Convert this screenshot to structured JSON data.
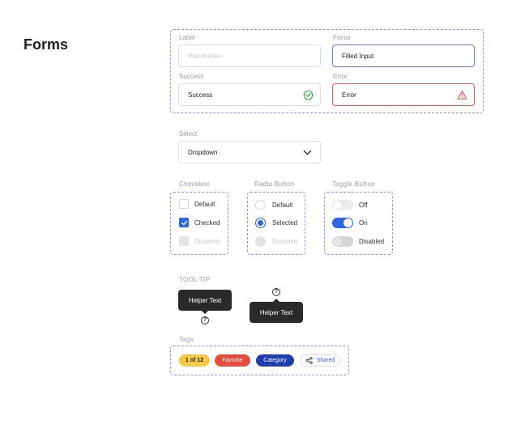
{
  "page": {
    "title": "Forms"
  },
  "inputs": {
    "label_caption": "Label",
    "label_placeholder": "Placeholder",
    "focus_caption": "Focus",
    "focus_value": "Filled Input",
    "success_caption": "Success",
    "success_value": "Success",
    "error_caption": "Error",
    "error_value": "Error"
  },
  "select": {
    "caption": "Select",
    "value": "Dropdown"
  },
  "checkbox": {
    "caption": "Checkbox",
    "items": [
      {
        "label": "Default",
        "state": "default"
      },
      {
        "label": "Checked",
        "state": "checked"
      },
      {
        "label": "Disabled",
        "state": "disabled"
      }
    ]
  },
  "radio": {
    "caption": "Radio Button",
    "items": [
      {
        "label": "Default",
        "state": "default"
      },
      {
        "label": "Selected",
        "state": "selected"
      },
      {
        "label": "Disabled",
        "state": "disabled"
      }
    ]
  },
  "toggle": {
    "caption": "Toggle Button",
    "items": [
      {
        "label": "Off",
        "state": "off"
      },
      {
        "label": "On",
        "state": "on"
      },
      {
        "label": "Disabled",
        "state": "disabled"
      }
    ]
  },
  "tooltip": {
    "caption": "TOOL TIP",
    "tip1": "Helper Text",
    "tip2": "Helper Text",
    "help_glyph": "?"
  },
  "tags": {
    "caption": "Tags",
    "items": [
      {
        "label": "1 of 12",
        "bg": "#f7c948",
        "fg": "#222222"
      },
      {
        "label": "Favorite",
        "bg": "#e64b3c",
        "fg": "#ffffff"
      },
      {
        "label": "Category",
        "bg": "#1f3fae",
        "fg": "#ffffff"
      },
      {
        "label": "Shared",
        "bg": "#ffffff",
        "fg": "#2f66e0",
        "icon": "share-icon"
      }
    ]
  },
  "colors": {
    "accent": "#2f66e0",
    "success": "#2fa84f",
    "error": "#e45a5a",
    "dash": "#9b8cf0"
  }
}
